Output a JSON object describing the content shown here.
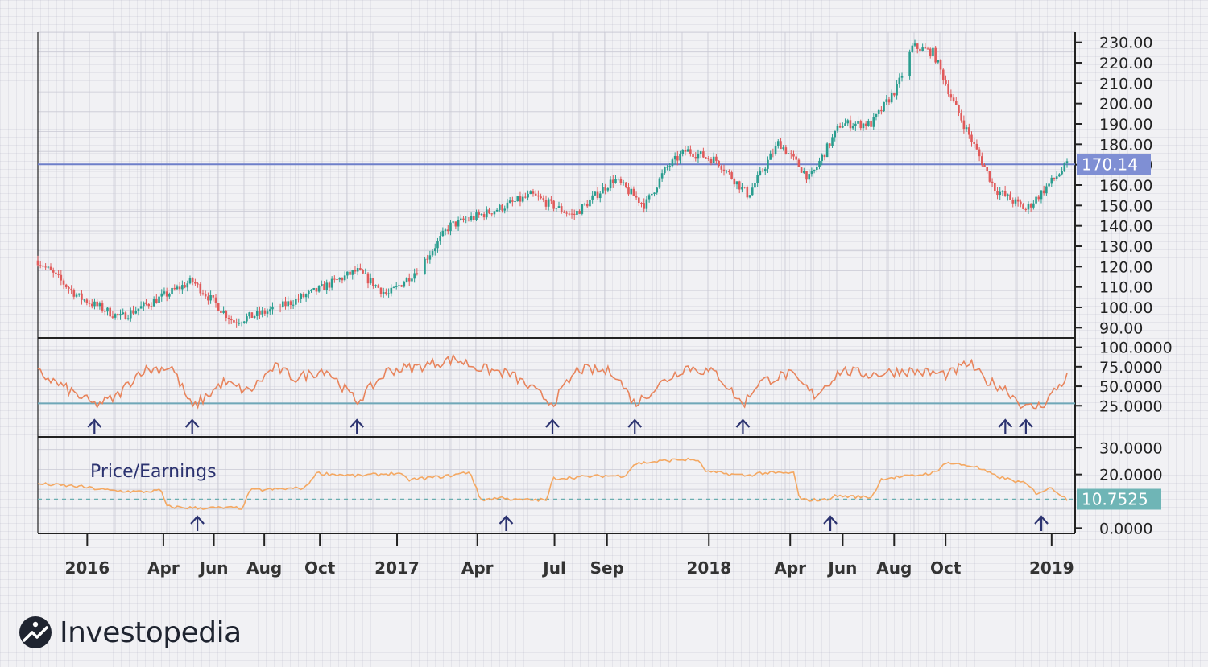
{
  "colors": {
    "up": "#2a9d8f",
    "down": "#e05a5a",
    "rsi_line": "#e8845c",
    "pe_line": "#f4a862",
    "price_ref": "#6e7fc9",
    "rsi_ref": "#6fa8b8",
    "pe_ref": "#6aaeb0",
    "arrow": "#2c3370",
    "price_badge": "#7f8fd4",
    "pe_badge": "#6fb5b6",
    "title": "#2c3370"
  },
  "chart_data": [
    {
      "type": "candlestick",
      "name": "price",
      "ylim": [
        85,
        235
      ],
      "yticks": [
        "90.00",
        "100.00",
        "110.00",
        "120.00",
        "130.00",
        "140.00",
        "150.00",
        "160.00",
        "170.00",
        "180.00",
        "190.00",
        "200.00",
        "210.00",
        "220.00",
        "230.00"
      ],
      "current_value": 170.14,
      "current_label": "170.14",
      "x": [
        0,
        0.04,
        0.08,
        0.12,
        0.15,
        0.19,
        0.23,
        0.27,
        0.31,
        0.34,
        0.37,
        0.4,
        0.44,
        0.48,
        0.52,
        0.56,
        0.59,
        0.61,
        0.63,
        0.66,
        0.69,
        0.72,
        0.75,
        0.78,
        0.81,
        0.835,
        0.85,
        0.87,
        0.89,
        0.93,
        0.96,
        1.0
      ],
      "close": [
        123,
        105,
        95,
        105,
        113,
        93,
        99,
        108,
        118,
        106,
        119,
        140,
        147,
        155,
        145,
        163,
        150,
        168,
        177,
        172,
        155,
        181,
        163,
        190,
        190,
        208,
        228,
        225,
        200,
        158,
        148,
        170
      ],
      "gaps": [
        [
          0.23,
          0.235
        ],
        [
          0.37,
          0.375
        ],
        [
          0.84,
          0.845
        ]
      ]
    },
    {
      "type": "line",
      "name": "rsi",
      "ylim": [
        0,
        100
      ],
      "yticks": [
        "100.0000",
        "75.0000",
        "50.0000",
        "25.0000"
      ],
      "ref_value": 28,
      "x": [
        0,
        0.03,
        0.055,
        0.075,
        0.1,
        0.13,
        0.15,
        0.18,
        0.205,
        0.23,
        0.25,
        0.28,
        0.31,
        0.34,
        0.37,
        0.405,
        0.43,
        0.46,
        0.5,
        0.525,
        0.56,
        0.58,
        0.61,
        0.63,
        0.66,
        0.685,
        0.7,
        0.73,
        0.755,
        0.78,
        0.81,
        0.84,
        0.86,
        0.885,
        0.905,
        0.92,
        0.94,
        0.96,
        0.975,
        1.0
      ],
      "values": [
        68,
        45,
        26,
        35,
        70,
        75,
        22,
        55,
        43,
        75,
        60,
        72,
        30,
        70,
        75,
        85,
        73,
        65,
        28,
        72,
        68,
        27,
        58,
        75,
        66,
        26,
        55,
        66,
        38,
        70,
        65,
        70,
        68,
        65,
        80,
        58,
        47,
        22,
        25,
        62
      ],
      "arrows": [
        0.055,
        0.15,
        0.31,
        0.5,
        0.58,
        0.685,
        0.94,
        0.96
      ]
    },
    {
      "type": "line",
      "name": "pe",
      "title": "Price/Earnings",
      "ylim": [
        -2,
        34
      ],
      "yticks": [
        "30.0000",
        "20.0000",
        "0.0000"
      ],
      "current_value": 10.7525,
      "current_label": "10.7525",
      "x": [
        0,
        0.04,
        0.07,
        0.1,
        0.12,
        0.125,
        0.15,
        0.2,
        0.205,
        0.26,
        0.27,
        0.31,
        0.35,
        0.36,
        0.4,
        0.42,
        0.43,
        0.455,
        0.46,
        0.495,
        0.5,
        0.55,
        0.57,
        0.58,
        0.62,
        0.64,
        0.65,
        0.69,
        0.7,
        0.735,
        0.74,
        0.765,
        0.775,
        0.81,
        0.82,
        0.85,
        0.875,
        0.88,
        0.91,
        0.93,
        0.935,
        0.96,
        0.97,
        0.985,
        1.0
      ],
      "values": [
        16.5,
        15.5,
        14,
        13.5,
        14,
        8,
        7.5,
        7.5,
        14,
        15,
        20.5,
        19.5,
        20.5,
        18,
        19.5,
        21,
        10.5,
        11.5,
        10.5,
        10.5,
        18.5,
        19.5,
        19.5,
        24,
        25.5,
        25.5,
        21,
        19.5,
        20.5,
        20.5,
        10.5,
        10.5,
        12,
        11.5,
        18.5,
        19.5,
        21,
        24.5,
        23,
        19.5,
        19,
        16.5,
        13,
        15,
        10.75
      ],
      "arrows": [
        0.155,
        0.455,
        0.77,
        0.975
      ]
    }
  ],
  "x_axis": {
    "labels": [
      {
        "text": "2016",
        "pos": 0.048
      },
      {
        "text": "Apr",
        "pos": 0.122
      },
      {
        "text": "Jun",
        "pos": 0.171
      },
      {
        "text": "Aug",
        "pos": 0.22
      },
      {
        "text": "Oct",
        "pos": 0.274
      },
      {
        "text": "2017",
        "pos": 0.349
      },
      {
        "text": "Apr",
        "pos": 0.427
      },
      {
        "text": "Jul",
        "pos": 0.502
      },
      {
        "text": "Sep",
        "pos": 0.553
      },
      {
        "text": "2018",
        "pos": 0.652
      },
      {
        "text": "Apr",
        "pos": 0.731
      },
      {
        "text": "Jun",
        "pos": 0.782
      },
      {
        "text": "Aug",
        "pos": 0.832
      },
      {
        "text": "Oct",
        "pos": 0.882
      },
      {
        "text": "2019",
        "pos": 0.985
      }
    ]
  },
  "brand": {
    "name": "Investopedia"
  }
}
